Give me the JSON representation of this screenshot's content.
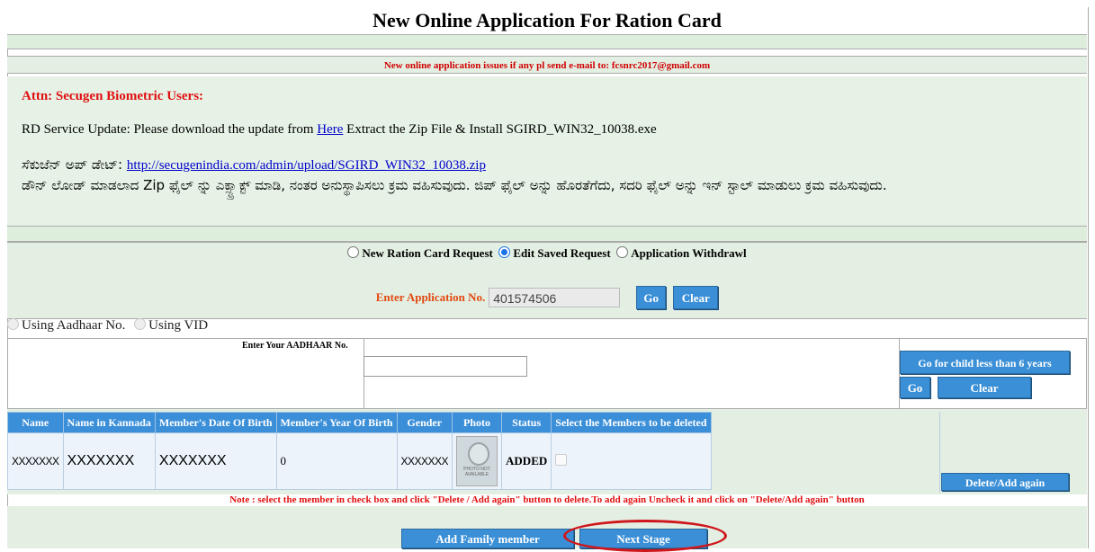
{
  "title": "New Online Application For Ration Card",
  "notice": "New online application issues if any pl send e-mail to: fcsnrc2017@gmail.com",
  "attn": "Attn: Secugen Biometric Users:",
  "rd_update": {
    "prefix": "RD Service Update: Please download the update from",
    "link": "Here",
    "suffix": "Extract the Zip File & Install SGIRD_WIN32_10038.exe"
  },
  "kannada": {
    "label": "ಸೆಕುಜೆನ್ ಅಪ್ ಡೇಟ್:",
    "url": "http://secugenindia.com/admin/upload/SGIRD_WIN32_10038.zip",
    "instruction": "ಡೌನ್ ಲೋಡ್ ಮಾಡಲಾದ Zip ಫೈಲ್ ನ್ನು ಎಕ್ಸ್ಟ್ರಾಕ್ಟ್ ಮಾಡಿ, ನಂತರ ಅನುಸ್ಥಾಪಿಸಲು ಕ್ರಮ ವಹಿಸುವುದು. ಜಿಪ್ ಫೈಲ್ ಅನ್ನು ಹೊರತೆಗೆದು, ಸದರಿ ಫೈಲ್ ಅನ್ನು ಇನ್ ಸ್ಟಾಲ್ ಮಾಡುಲು ಕ್ರಮ ವಹಿಸುವುದು."
  },
  "request_type": {
    "options": [
      "New Ration Card Request",
      "Edit Saved Request",
      "Application Withdrawl"
    ],
    "selected": "Edit Saved Request"
  },
  "application": {
    "label": "Enter Application No.",
    "value": "401574506",
    "go": "Go",
    "clear": "Clear"
  },
  "id_type": {
    "options": [
      "Using Aadhaar No.",
      "Using VID"
    ],
    "selected": "Using Aadhaar No."
  },
  "aadhaar": {
    "label": "Enter Your AADHAAR No.",
    "value": "",
    "child_btn": "Go for child less than 6 years",
    "go": "Go",
    "clear": "Clear"
  },
  "members": {
    "headers": [
      "Name",
      "Name in Kannada",
      "Member's Date Of Birth",
      "Member's Year Of Birth",
      "Gender",
      "Photo",
      "Status",
      "Select the Members to be deleted"
    ],
    "rows": [
      {
        "name": "XXXXXXX",
        "name_kn": "XXXXXXX",
        "dob": "XXXXXXX",
        "yob": "0",
        "gender": "XXXXXXX",
        "photo_text": "PHOTO NOT AVAILABLE",
        "status": "ADDED"
      }
    ],
    "delete_btn": "Delete/Add again"
  },
  "note": "Note : select the member in check box and click \"Delete / Add again\" button to delete.To add again Uncheck it and click on \"Delete/Add again\" button",
  "add_family_btn": "Add Family member",
  "next_stage_btn": "Next Stage",
  "colors": {
    "accent": "#3a8fd6",
    "alert": "#e01010",
    "band": "#ddeedd",
    "highlight": "#d0161b"
  }
}
